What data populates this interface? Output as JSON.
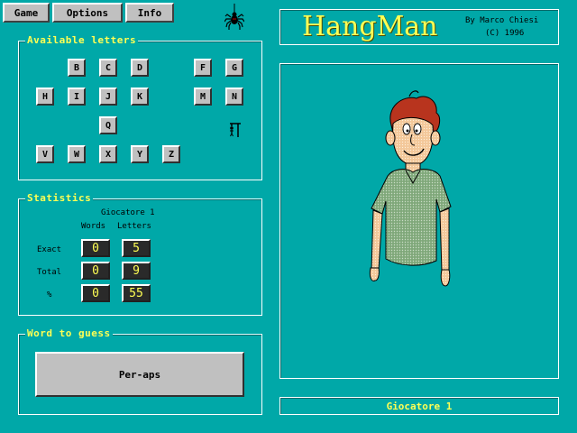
{
  "menu": {
    "game": "Game",
    "options": "Options",
    "info": "Info"
  },
  "letters_panel": {
    "title": "Available letters",
    "keys": [
      "B",
      "C",
      "D",
      "F",
      "G",
      "H",
      "I",
      "J",
      "K",
      "M",
      "N",
      "Q",
      "V",
      "W",
      "X",
      "Y",
      "Z"
    ]
  },
  "stats": {
    "title": "Statistics",
    "player": "Giocatore 1",
    "col_words": "Words",
    "col_letters": "Letters",
    "rows": [
      {
        "label": "Exact",
        "words": "0",
        "letters": "5"
      },
      {
        "label": "Total",
        "words": "0",
        "letters": "9"
      },
      {
        "label": "%",
        "words": "0",
        "letters": "55"
      }
    ]
  },
  "word": {
    "title": "Word to guess",
    "value": "Per-aps"
  },
  "header": {
    "title": "HangMan",
    "author": "By Marco Chiesi",
    "year": "(C) 1996"
  },
  "status": {
    "player": "Giocatore 1"
  },
  "colors": {
    "background": "#00a8a8",
    "accent": "#ffff54",
    "button": "#c0c0c0"
  }
}
